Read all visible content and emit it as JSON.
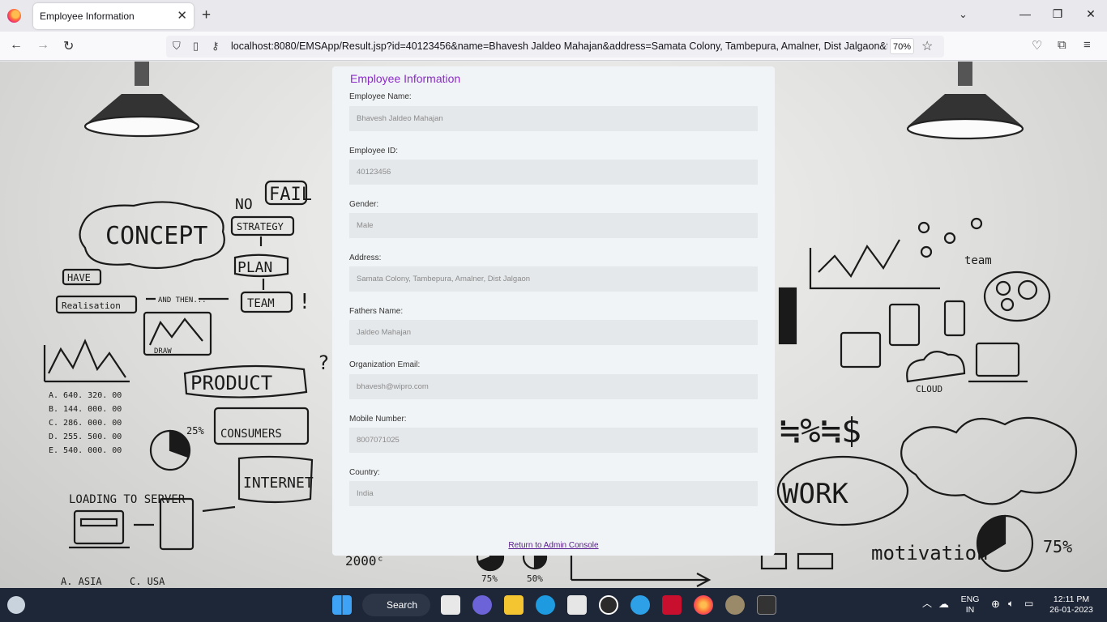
{
  "browser": {
    "tab_title": "Employee Information",
    "url_host": "localhost",
    "url_rest": ":8080/EMSApp/Result.jsp?id=40123456&name=Bhavesh Jaldeo Mahajan&address=Samata Colony, Tambepura, Amalner, Dist Jalgaon&fnar",
    "zoom": "70%"
  },
  "form": {
    "title": "Employee Information",
    "fields": [
      {
        "label": "Employee Name:",
        "value": "Bhavesh Jaldeo Mahajan"
      },
      {
        "label": "Employee ID:",
        "value": "40123456"
      },
      {
        "label": "Gender:",
        "value": "Male"
      },
      {
        "label": "Address:",
        "value": "Samata Colony, Tambepura, Amalner, Dist Jalgaon"
      },
      {
        "label": "Fathers Name:",
        "value": "Jaldeo Mahajan"
      },
      {
        "label": "Organization Email:",
        "value": "bhavesh@wipro.com"
      },
      {
        "label": "Mobile Number:",
        "value": "8007071025"
      },
      {
        "label": "Country:",
        "value": "India"
      }
    ],
    "return_link": "Return to Admin Console"
  },
  "background_sketch": {
    "words": [
      "CONCEPT",
      "FAIL",
      "NO",
      "STRATEGY",
      "PLAN",
      "TEAM",
      "PRODUCT",
      "CONSUMERS",
      "INTERNET",
      "LOADING TO SERVER",
      "HAVE",
      "Realisation",
      "AND THEN...",
      "DRAW",
      "WORK",
      "motivation",
      "team",
      "CLOUD",
      "75%",
      "25%",
      "50%"
    ]
  },
  "taskbar": {
    "search_label": "Search",
    "lang_top": "ENG",
    "lang_bottom": "IN",
    "time": "12:11 PM",
    "date": "26-01-2023"
  }
}
